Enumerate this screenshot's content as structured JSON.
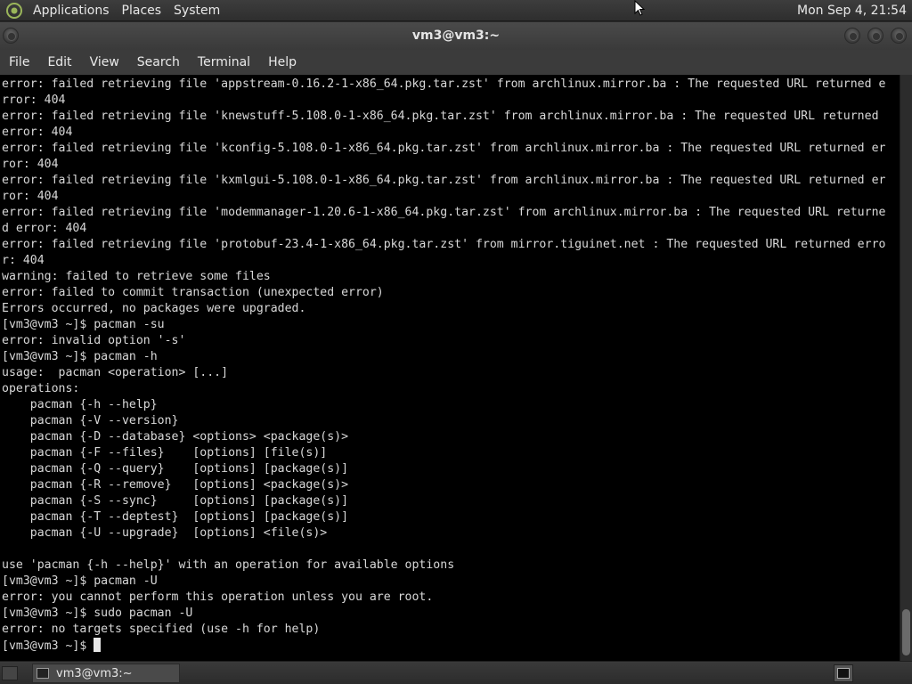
{
  "top_panel": {
    "menus": [
      "Applications",
      "Places",
      "System"
    ],
    "clock": "Mon Sep  4, 21:54"
  },
  "window": {
    "title": "vm3@vm3:~"
  },
  "menubar": {
    "items": [
      "File",
      "Edit",
      "View",
      "Search",
      "Terminal",
      "Help"
    ]
  },
  "terminal": {
    "lines": [
      "error: failed retrieving file 'appstream-0.16.2-1-x86_64.pkg.tar.zst' from archlinux.mirror.ba : The requested URL returned e",
      "rror: 404",
      "error: failed retrieving file 'knewstuff-5.108.0-1-x86_64.pkg.tar.zst' from archlinux.mirror.ba : The requested URL returned",
      "error: 404",
      "error: failed retrieving file 'kconfig-5.108.0-1-x86_64.pkg.tar.zst' from archlinux.mirror.ba : The requested URL returned er",
      "ror: 404",
      "error: failed retrieving file 'kxmlgui-5.108.0-1-x86_64.pkg.tar.zst' from archlinux.mirror.ba : The requested URL returned er",
      "ror: 404",
      "error: failed retrieving file 'modemmanager-1.20.6-1-x86_64.pkg.tar.zst' from archlinux.mirror.ba : The requested URL returne",
      "d error: 404",
      "error: failed retrieving file 'protobuf-23.4-1-x86_64.pkg.tar.zst' from mirror.tiguinet.net : The requested URL returned erro",
      "r: 404",
      "warning: failed to retrieve some files",
      "error: failed to commit transaction (unexpected error)",
      "Errors occurred, no packages were upgraded.",
      "[vm3@vm3 ~]$ pacman -su",
      "error: invalid option '-s'",
      "[vm3@vm3 ~]$ pacman -h",
      "usage:  pacman <operation> [...]",
      "operations:",
      "    pacman {-h --help}",
      "    pacman {-V --version}",
      "    pacman {-D --database} <options> <package(s)>",
      "    pacman {-F --files}    [options] [file(s)]",
      "    pacman {-Q --query}    [options] [package(s)]",
      "    pacman {-R --remove}   [options] <package(s)>",
      "    pacman {-S --sync}     [options] [package(s)]",
      "    pacman {-T --deptest}  [options] [package(s)]",
      "    pacman {-U --upgrade}  [options] <file(s)>",
      "",
      "use 'pacman {-h --help}' with an operation for available options",
      "[vm3@vm3 ~]$ pacman -U",
      "error: you cannot perform this operation unless you are root.",
      "[vm3@vm3 ~]$ sudo pacman -U",
      "error: no targets specified (use -h for help)"
    ],
    "prompt": "[vm3@vm3 ~]$ "
  },
  "taskbar": {
    "task_label": "vm3@vm3:~"
  },
  "colors": {
    "terminal_bg": "#000000",
    "terminal_fg": "#d8d8d8",
    "panel_bg": "#333333"
  }
}
